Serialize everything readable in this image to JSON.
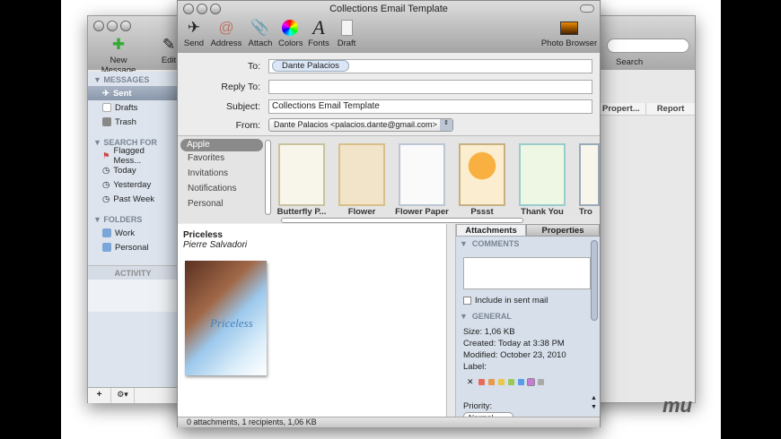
{
  "back_window": {
    "toolbar": {
      "new_message": "New Message",
      "edit": "Edit",
      "search": "Search"
    },
    "columns": [
      "Propert...",
      "Report"
    ],
    "sidebar": {
      "sections": [
        {
          "title": "MESSAGES",
          "items": [
            "Sent",
            "Drafts",
            "Trash"
          ]
        },
        {
          "title": "SEARCH FOR",
          "items": [
            "Flagged Mess...",
            "Today",
            "Yesterday",
            "Past Week"
          ]
        },
        {
          "title": "FOLDERS",
          "items": [
            "Work",
            "Personal"
          ]
        }
      ],
      "activity": "ACTIVITY",
      "add_button": "+",
      "gear_button": "⚙▾"
    }
  },
  "window": {
    "title": "Collections Email Template",
    "toolbar": [
      "Send",
      "Address",
      "Attach",
      "Colors",
      "Fonts",
      "Draft"
    ],
    "photo_browser": "Photo Browser",
    "to_label": "To:",
    "to_token": "Dante Palacios",
    "reply_to_label": "Reply To:",
    "reply_to_value": "",
    "subject_label": "Subject:",
    "subject_value": "Collections Email Template",
    "from_label": "From:",
    "from_value": "Dante Palacios <palacios.dante@gmail.com>",
    "categories": [
      "Apple",
      "Favorites",
      "Invitations",
      "Notifications",
      "Personal"
    ],
    "templates": [
      "Butterfly P...",
      "Flower",
      "Flower Paper",
      "Pssst",
      "Thank You",
      "Tro"
    ],
    "body": {
      "title": "Priceless",
      "author": "Pierre Salvadori",
      "poster_title": "Priceless"
    },
    "status": "0 attachments, 1 recipients, 1,06 KB",
    "panel": {
      "tabs": [
        "Attachments",
        "Properties"
      ],
      "comments": "COMMENTS",
      "include": "Include in sent mail",
      "general": "GENERAL",
      "size": "Size: 1,06 KB",
      "created": "Created: Today at 3:38 PM",
      "modified": "Modified: October 23, 2010",
      "label": "Label:",
      "label_colors": [
        "#e86a5a",
        "#e89a4a",
        "#e8c84a",
        "#9ac85a",
        "#5a9ae8",
        "#c87ad8",
        "#aaaaaa"
      ],
      "priority": "Priority:",
      "priority_value": "Normal"
    }
  }
}
